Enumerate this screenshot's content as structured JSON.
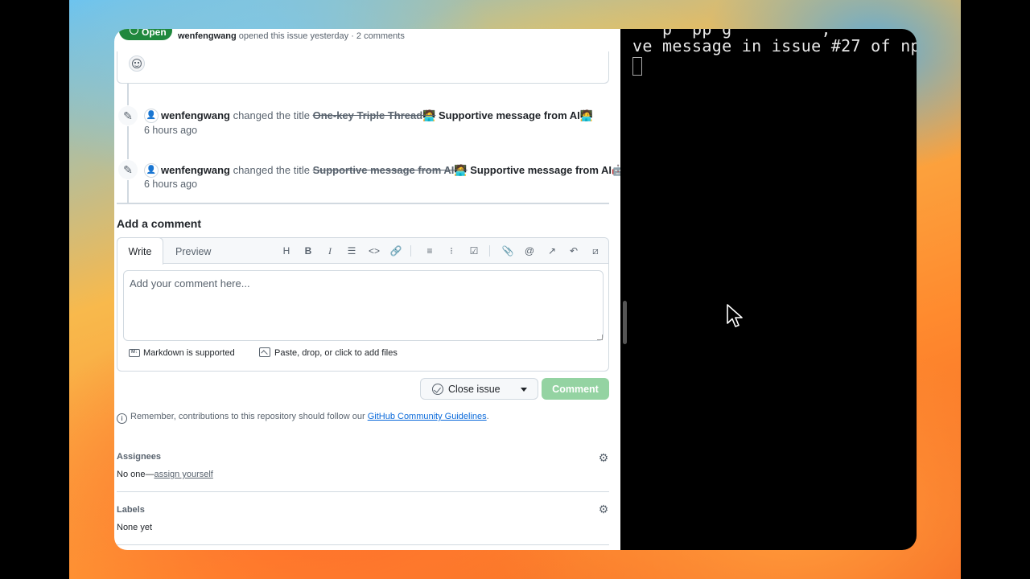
{
  "issue": {
    "status": "Open",
    "author": "wenfengwang",
    "meta_text": "opened this issue yesterday · 2 comments"
  },
  "timeline": [
    {
      "user": "wenfengwang",
      "action": "changed the title",
      "old_title": "One-key Triple Thread🧑‍💻",
      "new_title": "Supportive message from AI🧑‍💻",
      "time": "6 hours ago"
    },
    {
      "user": "wenfengwang",
      "action": "changed the title",
      "old_title": "Supportive message from AI🧑‍💻",
      "new_title": "Supportive message from AI🤖",
      "time": "6 hours ago"
    }
  ],
  "composer": {
    "title": "Add a comment",
    "tab_write": "Write",
    "tab_preview": "Preview",
    "placeholder": "Add your comment here...",
    "markdown_note": "Markdown is supported",
    "files_note": "Paste, drop, or click to add files",
    "close_issue_label": "Close issue",
    "comment_label": "Comment",
    "toolbar": {
      "heading": "H",
      "bold": "B",
      "italic": "I"
    }
  },
  "guidelines": {
    "prefix": "Remember, contributions to this repository should follow our",
    "link": "GitHub Community Guidelines",
    "suffix": "."
  },
  "sidebar": {
    "assignees_title": "Assignees",
    "assignees_none": "No one—",
    "assign_yourself": "assign yourself",
    "labels_title": "Labels",
    "labels_value": "None yet"
  },
  "terminal": {
    "line_top": "   p  pp g         , ",
    "line_main": "ve message in issue #27 of np"
  },
  "colors": {
    "open_green": "#1f883d",
    "comment_disabled": "#94d3a2",
    "link_blue": "#0969da"
  }
}
